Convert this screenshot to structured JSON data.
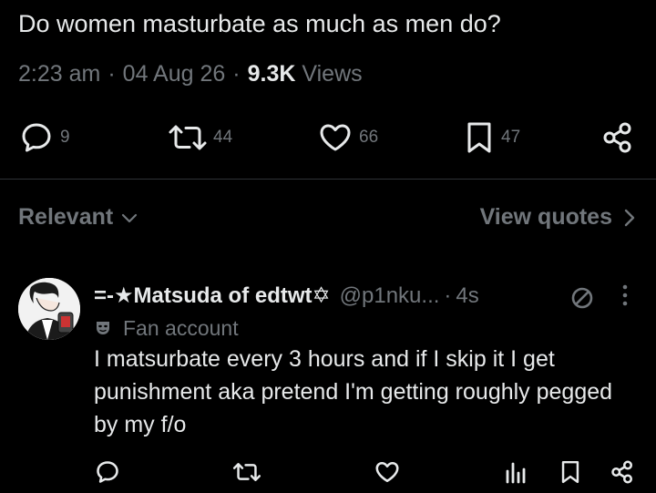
{
  "post": {
    "text": "Do women masturbate as much as men do?",
    "time": "2:23 am",
    "date": "04 Aug 26",
    "views_count": "9.3K",
    "views_label": "Views",
    "replies": "9",
    "reposts": "44",
    "likes": "66",
    "bookmarks": "47"
  },
  "filters": {
    "relevant_label": "Relevant",
    "view_quotes_label": "View quotes"
  },
  "reply": {
    "name": "=-★Matsuda of edtwt✡",
    "handle": "@p1nku...",
    "time": "4s",
    "label": "Fan account",
    "text": "I matsurbate every 3 hours and if I skip it I get punishment aka pretend I'm getting roughly pegged by my f/o"
  },
  "icons": {
    "reply": "speech-bubble-icon",
    "repost": "repost-arrows-icon",
    "like": "heart-icon",
    "bookmark": "bookmark-icon",
    "share": "share-icon",
    "views": "bar-chart-icon",
    "muted": "no-entry-icon",
    "more": "vertical-dots-icon",
    "fan": "mask-icon"
  },
  "colors": {
    "background": "#000000",
    "text": "#e7e9ea",
    "muted": "#71767b",
    "divider": "#2f3336"
  }
}
